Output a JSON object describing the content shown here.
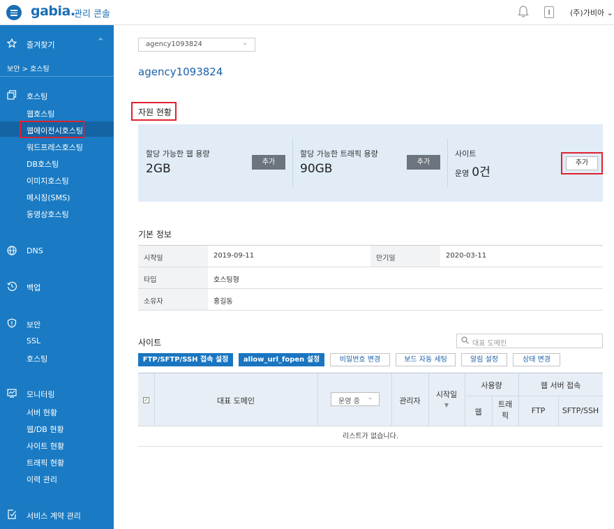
{
  "header": {
    "logo": "gabia.",
    "console_title": "관리 콘솔",
    "org_menu": "(주)가비아"
  },
  "sidebar": {
    "favorites": "즐겨찾기",
    "breadcrumb": "보안 > 호스팅",
    "hosting": {
      "title": "호스팅",
      "items": [
        "웹호스팅",
        "웹에이전시호스팅",
        "워드프레스호스팅",
        "DB호스팅",
        "이미지호스팅",
        "메시징(SMS)",
        "동영상호스팅"
      ]
    },
    "dns": "DNS",
    "backup": "백업",
    "security": {
      "title": "보안",
      "items": [
        "SSL",
        "호스팅"
      ]
    },
    "monitoring": {
      "title": "모니터링",
      "items": [
        "서버 현황",
        "웹/DB 현황",
        "사이트 현황",
        "트래픽 현황",
        "이력 관리"
      ]
    },
    "contract": "서비스 계약 관리"
  },
  "main": {
    "account_select": "agency1093824",
    "account_title": "agency1093824",
    "resources": {
      "heading": "자원 현황",
      "web": {
        "label": "할당 가능한 웹 용량",
        "value": "2GB",
        "button": "추가"
      },
      "traffic": {
        "label": "할당 가능한 트래픽 용량",
        "value": "90GB",
        "button": "추가"
      },
      "site": {
        "label": "사이트",
        "prefix": "운영",
        "value": "0건",
        "button": "추가"
      }
    },
    "basic_info": {
      "heading": "기본 정보",
      "start_label": "시작일",
      "start_value": "2019-09-11",
      "expire_label": "만기일",
      "expire_value": "2020-03-11",
      "type_label": "타입",
      "type_value": "호스팅형",
      "owner_label": "소유자",
      "owner_value": "홍길동"
    },
    "sites": {
      "heading": "사이트",
      "search_placeholder": "대표 도메인",
      "buttons": [
        "FTP/SFTP/SSH 접속 설정",
        "allow_url_fopen 설정",
        "비밀번호 변경",
        "보드 자동 세팅",
        "알림 설정",
        "상태 변경"
      ],
      "table": {
        "col_domain": "대표 도메인",
        "status_filter": "운영 중",
        "col_admin": "관리자",
        "col_start": "시작일",
        "col_usage": "사용량",
        "col_usage_web": "웹",
        "col_usage_traffic_1": "트래",
        "col_usage_traffic_2": "픽",
        "col_access": "웹 서버 접속",
        "col_ftp": "FTP",
        "col_sftp": "SFTP/SSH",
        "empty": "리스트가 없습니다."
      }
    }
  }
}
